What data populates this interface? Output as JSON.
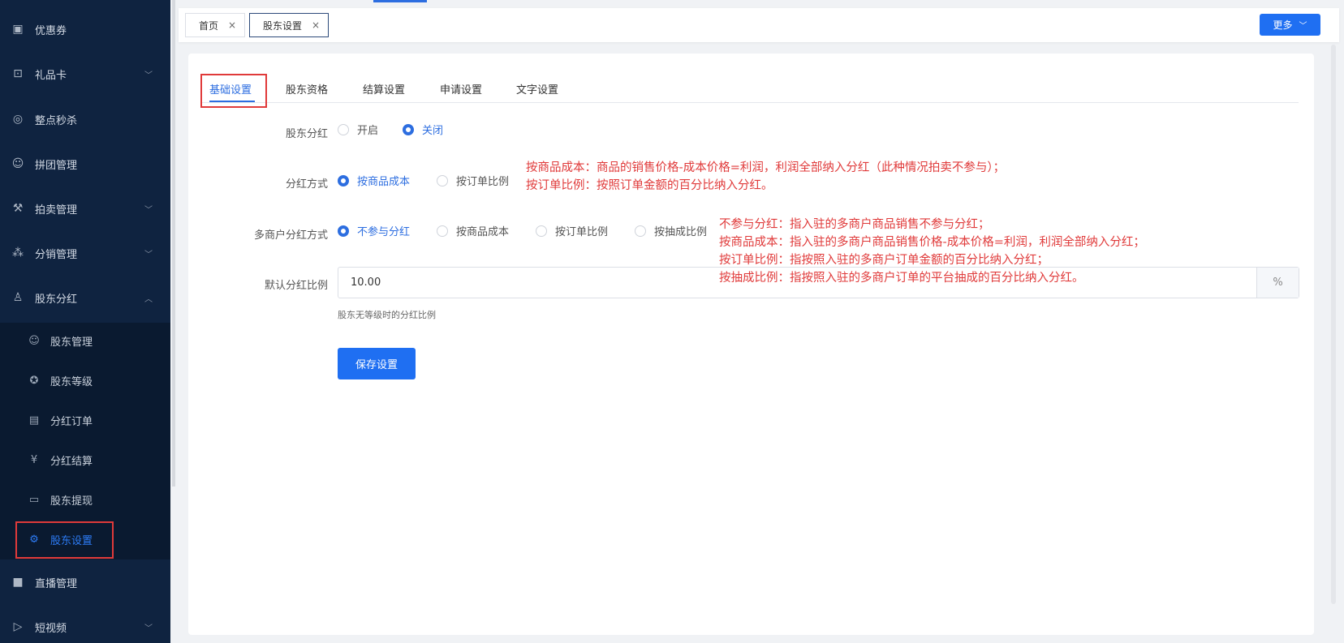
{
  "sidebar": {
    "items": [
      {
        "label": "优惠券",
        "icon": "ticket-icon"
      },
      {
        "label": "礼品卡",
        "icon": "gift-card-icon"
      },
      {
        "label": "整点秒杀",
        "icon": "flash-sale-icon"
      },
      {
        "label": "拼团管理",
        "icon": "group-buy-icon"
      },
      {
        "label": "拍卖管理",
        "icon": "auction-gavel-icon"
      },
      {
        "label": "分销管理",
        "icon": "distribution-icon"
      },
      {
        "label": "股东分红",
        "icon": "shareholder-icon"
      },
      {
        "label": "直播管理",
        "icon": "video-camera-icon"
      },
      {
        "label": "短视频",
        "icon": "play-icon"
      }
    ],
    "sub_items": [
      {
        "label": "股东管理",
        "icon": "user-icon"
      },
      {
        "label": "股东等级",
        "icon": "badge-icon"
      },
      {
        "label": "分红订单",
        "icon": "document-icon"
      },
      {
        "label": "分红结算",
        "icon": "yuan-coin-icon"
      },
      {
        "label": "股东提现",
        "icon": "wallet-icon"
      },
      {
        "label": "股东设置",
        "icon": "gear-icon"
      }
    ]
  },
  "page_tabs": {
    "tabs": [
      {
        "label": "首页",
        "close": "×"
      },
      {
        "label": "股东设置",
        "close": "×"
      }
    ],
    "more": "更多"
  },
  "settings_tabs": [
    "基础设置",
    "股东资格",
    "结算设置",
    "申请设置",
    "文字设置"
  ],
  "form": {
    "dividend": {
      "label": "股东分红",
      "options": [
        "开启",
        "关闭"
      ],
      "selected": "关闭"
    },
    "method": {
      "label": "分红方式",
      "options": [
        "按商品成本",
        "按订单比例"
      ],
      "selected": "按商品成本"
    },
    "multi_method": {
      "label": "多商户分红方式",
      "options": [
        "不参与分红",
        "按商品成本",
        "按订单比例",
        "按抽成比例"
      ],
      "selected": "不参与分红"
    },
    "ratio": {
      "label": "默认分红比例",
      "value": "10.00",
      "suffix": "%",
      "hint": "股东无等级时的分红比例"
    },
    "save": "保存设置"
  },
  "notes": {
    "method": [
      "按商品成本：商品的销售价格-成本价格=利润，利润全部纳入分红（此种情况拍卖不参与）；",
      "按订单比例：按照订单金额的百分比纳入分红。"
    ],
    "multi": [
      "不参与分红：指入驻的多商户商品销售不参与分红；",
      "按商品成本：指入驻的多商户商品销售价格-成本价格=利润，利润全部纳入分红；",
      "按订单比例：指按照入驻的多商户订单金额的百分比纳入分红；",
      "按抽成比例：指按照入驻的多商户订单的平台抽成的百分比纳入分红。"
    ]
  },
  "colors": {
    "accent": "#2d6ee0",
    "sidebar_bg": "#0f2340",
    "annotation": "#e03a3a"
  }
}
